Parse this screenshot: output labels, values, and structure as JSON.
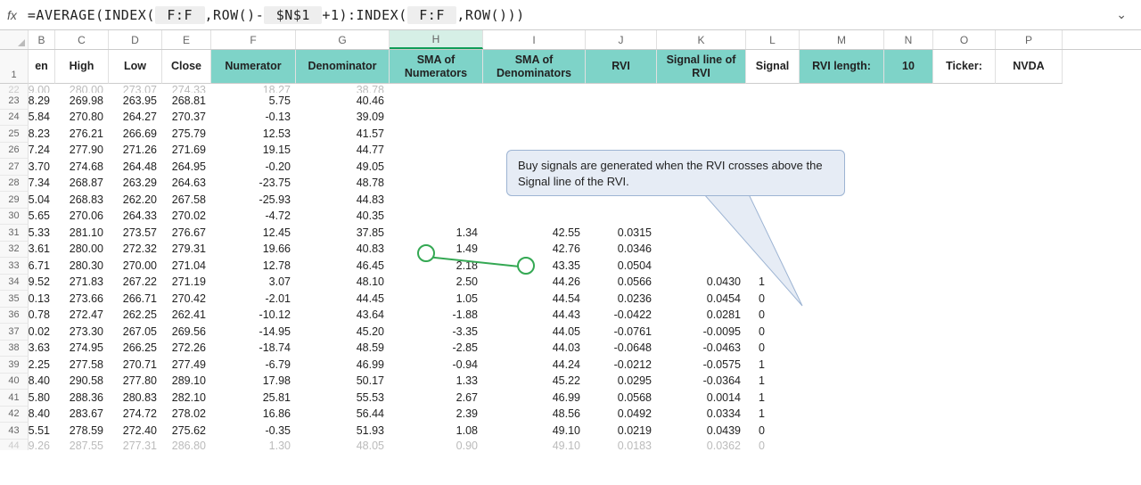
{
  "formula_bar": {
    "fx": "fx",
    "prefix": "=AVERAGE(INDEX(",
    "ref1": " F:F ",
    "mid1": ",ROW()-",
    "ref2": " $N$1 ",
    "mid2": "+1):INDEX(",
    "ref3": " F:F ",
    "suffix": ",ROW()))",
    "collapse": "⌄"
  },
  "col_letters": [
    "",
    "B",
    "C",
    "D",
    "E",
    "F",
    "G",
    "H",
    "I",
    "J",
    "K",
    "L",
    "M",
    "N",
    "O",
    "P"
  ],
  "selected_col": "H",
  "headers": {
    "row_num": "1",
    "B": "en",
    "C": "High",
    "D": "Low",
    "E": "Close",
    "F": "Numerator",
    "G": "Denominator",
    "H": "SMA of Numerators",
    "I": "SMA of Denominators",
    "J": "RVI",
    "K": "Signal line of RVI",
    "L": "Signal",
    "M": "RVI length:",
    "N": "10",
    "O": "Ticker:",
    "P": "NVDA"
  },
  "callout_text": "Buy signals are generated when the RVI crosses above the Signal line of the RVI.",
  "chart_data": {
    "type": "table",
    "rows": [
      {
        "n": "22",
        "B": "9.00",
        "C": "280.00",
        "D": "273.07",
        "E": "274.33",
        "F": "18.27",
        "G": "38.78"
      },
      {
        "n": "23",
        "B": "8.29",
        "C": "269.98",
        "D": "263.95",
        "E": "268.81",
        "F": "5.75",
        "G": "40.46"
      },
      {
        "n": "24",
        "B": "5.84",
        "C": "270.80",
        "D": "264.27",
        "E": "270.37",
        "F": "-0.13",
        "G": "39.09"
      },
      {
        "n": "25",
        "B": "8.23",
        "C": "276.21",
        "D": "266.69",
        "E": "275.79",
        "F": "12.53",
        "G": "41.57"
      },
      {
        "n": "26",
        "B": "7.24",
        "C": "277.90",
        "D": "271.26",
        "E": "271.69",
        "F": "19.15",
        "G": "44.77"
      },
      {
        "n": "27",
        "B": "3.70",
        "C": "274.68",
        "D": "264.48",
        "E": "264.95",
        "F": "-0.20",
        "G": "49.05"
      },
      {
        "n": "28",
        "B": "7.34",
        "C": "268.87",
        "D": "263.29",
        "E": "264.63",
        "F": "-23.75",
        "G": "48.78"
      },
      {
        "n": "29",
        "B": "5.04",
        "C": "268.83",
        "D": "262.20",
        "E": "267.58",
        "F": "-25.93",
        "G": "44.83"
      },
      {
        "n": "30",
        "B": "5.65",
        "C": "270.06",
        "D": "264.33",
        "E": "270.02",
        "F": "-4.72",
        "G": "40.35"
      },
      {
        "n": "31",
        "B": "5.33",
        "C": "281.10",
        "D": "273.57",
        "E": "276.67",
        "F": "12.45",
        "G": "37.85",
        "H": "1.34",
        "I": "42.55",
        "J": "0.0315"
      },
      {
        "n": "32",
        "B": "3.61",
        "C": "280.00",
        "D": "272.32",
        "E": "279.31",
        "F": "19.66",
        "G": "40.83",
        "H": "1.49",
        "I": "42.76",
        "J": "0.0346"
      },
      {
        "n": "33",
        "B": "6.71",
        "C": "280.30",
        "D": "270.00",
        "E": "271.04",
        "F": "12.78",
        "G": "46.45",
        "H": "2.18",
        "I": "43.35",
        "J": "0.0504"
      },
      {
        "n": "34",
        "B": "9.52",
        "C": "271.83",
        "D": "267.22",
        "E": "271.19",
        "F": "3.07",
        "G": "48.10",
        "H": "2.50",
        "I": "44.26",
        "J": "0.0566",
        "K": "0.0430",
        "L": "1"
      },
      {
        "n": "35",
        "B": "0.13",
        "C": "273.66",
        "D": "266.71",
        "E": "270.42",
        "F": "-2.01",
        "G": "44.45",
        "H": "1.05",
        "I": "44.54",
        "J": "0.0236",
        "K": "0.0454",
        "L": "0"
      },
      {
        "n": "36",
        "B": "0.78",
        "C": "272.47",
        "D": "262.25",
        "E": "262.41",
        "F": "-10.12",
        "G": "43.64",
        "H": "-1.88",
        "I": "44.43",
        "J": "-0.0422",
        "K": "0.0281",
        "L": "0"
      },
      {
        "n": "37",
        "B": "0.02",
        "C": "273.30",
        "D": "267.05",
        "E": "269.56",
        "F": "-14.95",
        "G": "45.20",
        "H": "-3.35",
        "I": "44.05",
        "J": "-0.0761",
        "K": "-0.0095",
        "L": "0"
      },
      {
        "n": "38",
        "B": "3.63",
        "C": "274.95",
        "D": "266.25",
        "E": "272.26",
        "F": "-18.74",
        "G": "48.59",
        "H": "-2.85",
        "I": "44.03",
        "J": "-0.0648",
        "K": "-0.0463",
        "L": "0"
      },
      {
        "n": "39",
        "B": "2.25",
        "C": "277.58",
        "D": "270.71",
        "E": "277.49",
        "F": "-6.79",
        "G": "46.99",
        "H": "-0.94",
        "I": "44.24",
        "J": "-0.0212",
        "K": "-0.0575",
        "L": "1"
      },
      {
        "n": "40",
        "B": "8.40",
        "C": "290.58",
        "D": "277.80",
        "E": "289.10",
        "F": "17.98",
        "G": "50.17",
        "H": "1.33",
        "I": "45.22",
        "J": "0.0295",
        "K": "-0.0364",
        "L": "1"
      },
      {
        "n": "41",
        "B": "5.80",
        "C": "288.36",
        "D": "280.83",
        "E": "282.10",
        "F": "25.81",
        "G": "55.53",
        "H": "2.67",
        "I": "46.99",
        "J": "0.0568",
        "K": "0.0014",
        "L": "1"
      },
      {
        "n": "42",
        "B": "8.40",
        "C": "283.67",
        "D": "274.72",
        "E": "278.02",
        "F": "16.86",
        "G": "56.44",
        "H": "2.39",
        "I": "48.56",
        "J": "0.0492",
        "K": "0.0334",
        "L": "1"
      },
      {
        "n": "43",
        "B": "5.51",
        "C": "278.59",
        "D": "272.40",
        "E": "275.62",
        "F": "-0.35",
        "G": "51.93",
        "H": "1.08",
        "I": "49.10",
        "J": "0.0219",
        "K": "0.0439",
        "L": "0"
      },
      {
        "n": "44",
        "B": "9.26",
        "C": "287.55",
        "D": "277.31",
        "E": "286.80",
        "F": "1.30",
        "G": "48.05",
        "H": "0.90",
        "I": "49.10",
        "J": "0.0183",
        "K": "0.0362",
        "L": "0"
      }
    ]
  }
}
